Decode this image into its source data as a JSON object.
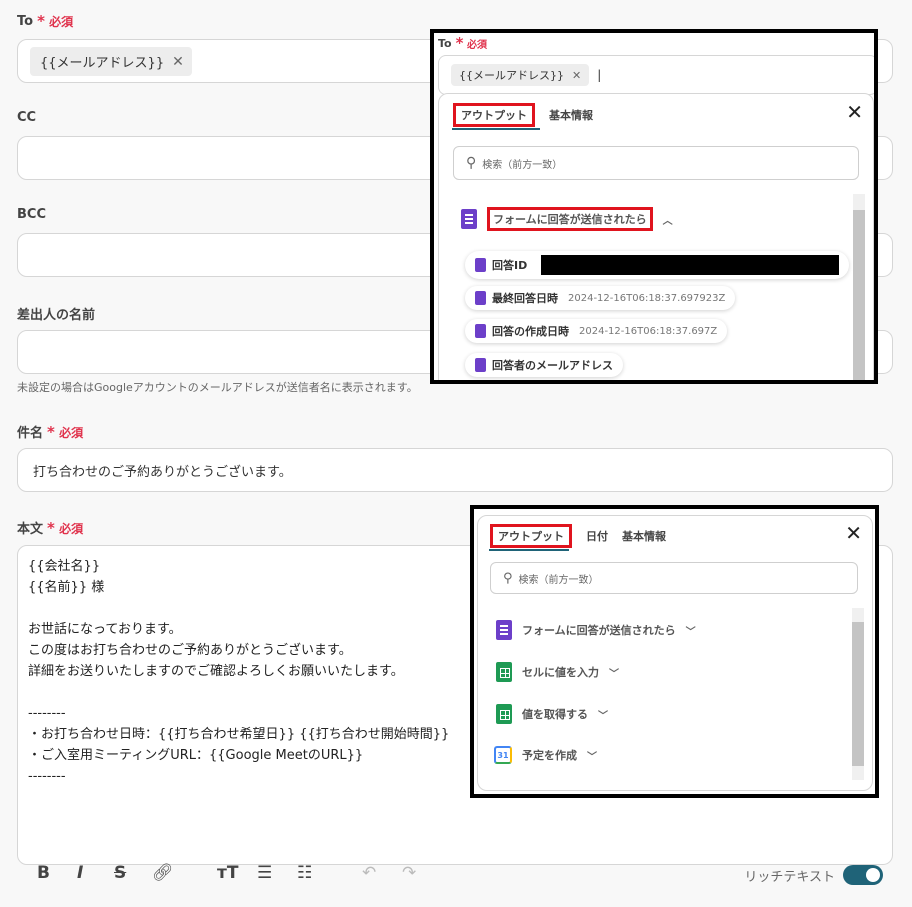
{
  "to": {
    "label": "To",
    "required": "必須",
    "chip": "{{メールアドレス}}"
  },
  "cc": {
    "label": "CC"
  },
  "bcc": {
    "label": "BCC"
  },
  "sender": {
    "label": "差出人の名前",
    "hint": "未設定の場合はGoogleアカウントのメールアドレスが送信者名に表示されます。"
  },
  "subject": {
    "label": "件名",
    "required": "必須",
    "value": "打ち合わせのご予約ありがとうございます。"
  },
  "body": {
    "label": "本文",
    "required": "必須",
    "lines": [
      "{{会社名}}",
      "{{名前}} 様",
      "",
      "お世話になっております。",
      "この度はお打ち合わせのご予約ありがとうございます。",
      "詳細をお送りいたしますのでご確認よろしくお願いいたします。",
      "",
      "--------",
      "・お打ち合わせ日時：{{打ち合わせ希望日}} {{打ち合わせ開始時間}}",
      "・ご入室用ミーティングURL：{{Google MeetのURL}}",
      "--------"
    ]
  },
  "toolbar": {
    "rich_text_label": "リッチテキスト"
  },
  "panel1": {
    "to_label": "To",
    "required": "必須",
    "chip": "{{メールアドレス}}",
    "tabs": [
      "アウトプット",
      "基本情報"
    ],
    "search_placeholder": "検索（前方一致）",
    "group": "フォームに回答が送信されたら",
    "items": [
      {
        "name": "回答ID",
        "value": ""
      },
      {
        "name": "最終回答日時",
        "value": "2024-12-16T06:18:37.697923Z"
      },
      {
        "name": "回答の作成日時",
        "value": "2024-12-16T06:18:37.697Z"
      },
      {
        "name": "回答者のメールアドレス",
        "value": ""
      }
    ]
  },
  "panel2": {
    "tabs": [
      "アウトプット",
      "日付",
      "基本情報"
    ],
    "search_placeholder": "検索（前方一致）",
    "groups": [
      {
        "name": "フォームに回答が送信されたら",
        "icon": "google-forms-icon"
      },
      {
        "name": "セルに値を入力",
        "icon": "google-sheets-icon"
      },
      {
        "name": "値を取得する",
        "icon": "google-sheets-icon"
      },
      {
        "name": "予定を作成",
        "icon": "google-calendar-icon"
      }
    ],
    "calendar_icon_text": "31"
  },
  "colors": {
    "accent": "#1f6378",
    "required": "#e0334d",
    "highlight": "#e0141e"
  }
}
